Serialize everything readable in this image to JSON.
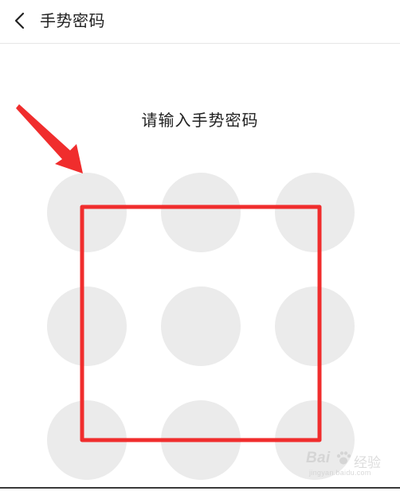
{
  "header": {
    "back_icon": "chevron-left-icon",
    "title": "手势密码"
  },
  "main": {
    "prompt": "请输入手势密码",
    "pattern_dot_count": 9
  },
  "annotations": {
    "highlight_color": "#f02d2d",
    "arrow_color": "#f02d2d"
  },
  "watermark": {
    "brand": "Bai",
    "suffix": "经验",
    "url": "jingyan.baidu.com"
  },
  "colors": {
    "dot": "#ebebeb",
    "text": "#222222",
    "background": "#ffffff"
  }
}
